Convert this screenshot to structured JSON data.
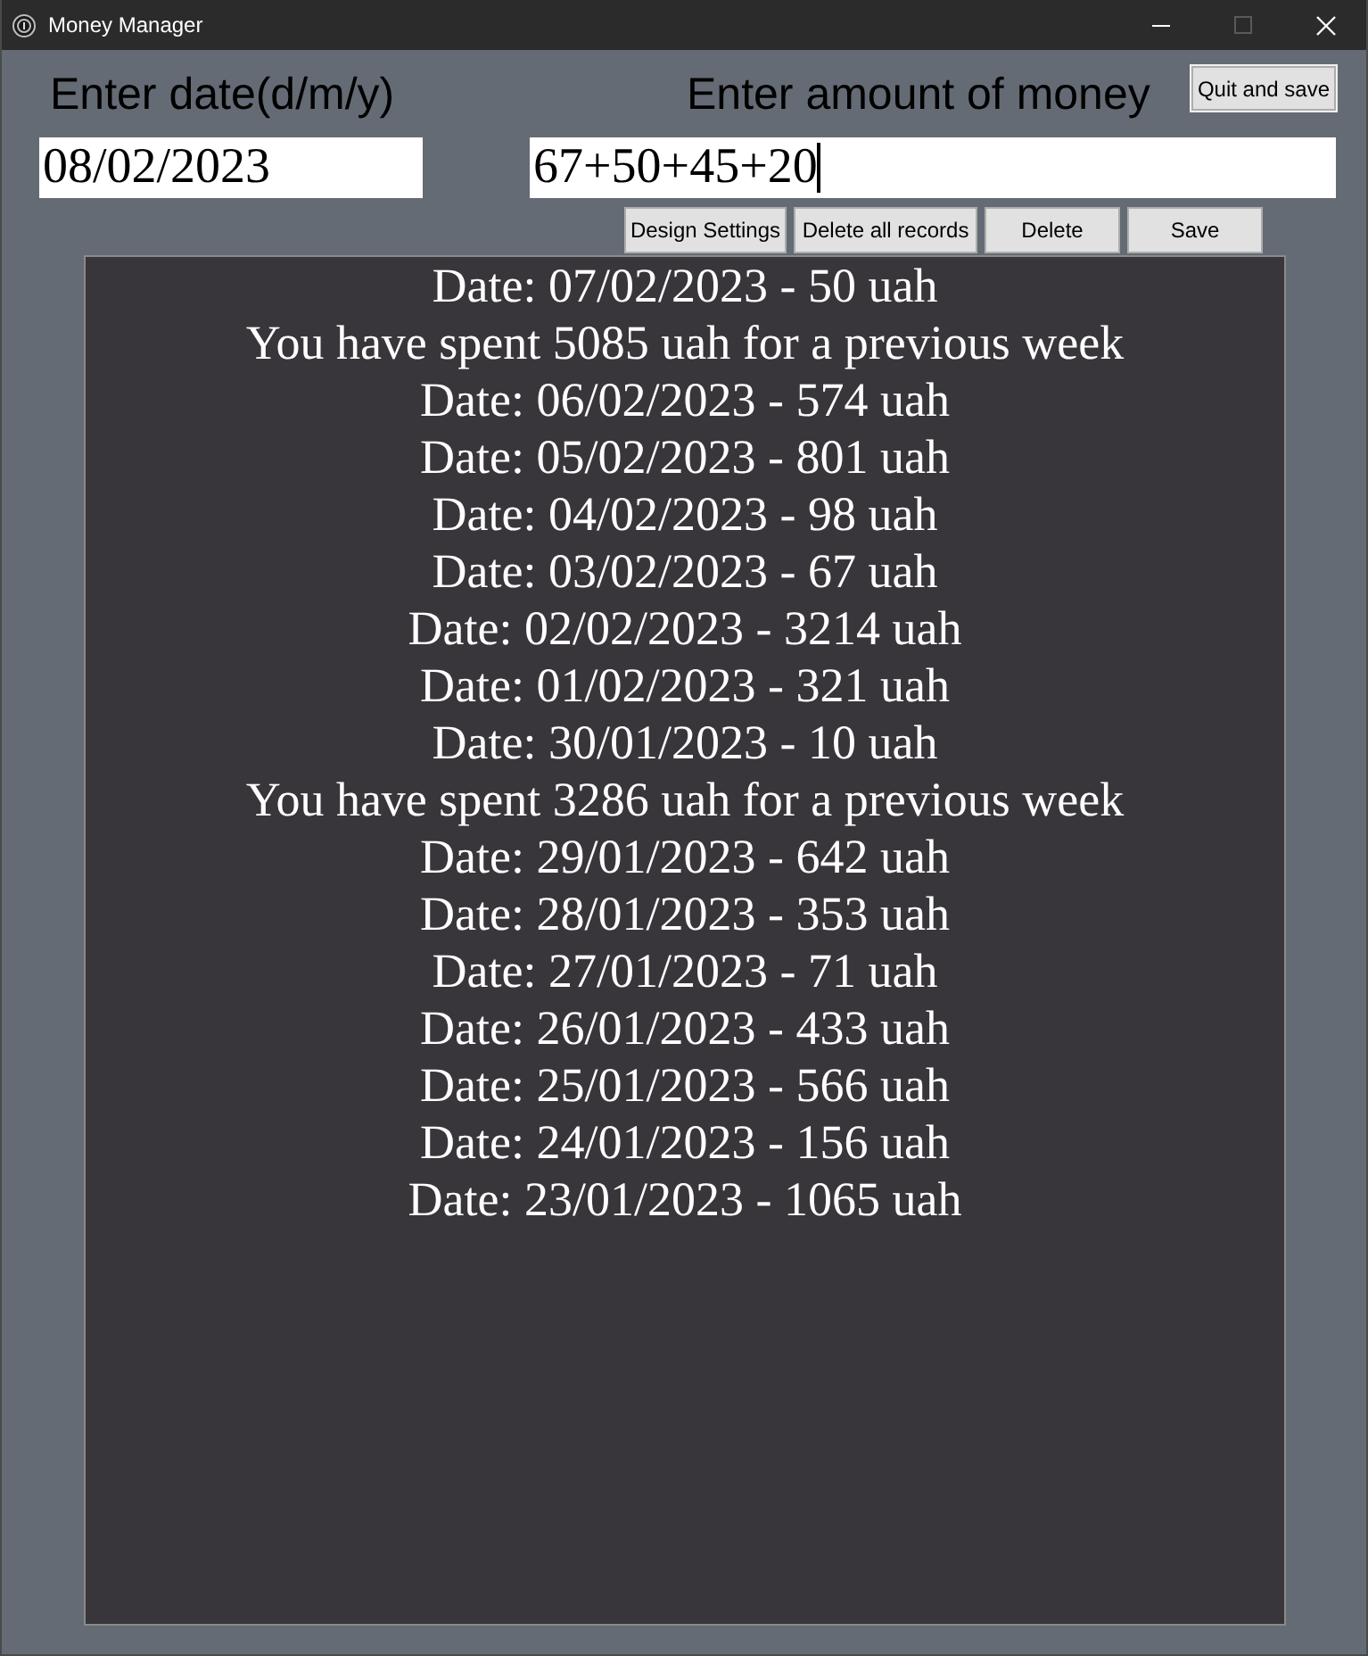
{
  "window": {
    "title": "Money Manager",
    "maximize_disabled": true
  },
  "fields": [
    {
      "label": "Enter date(d/m/y)",
      "value": "08/02/2023",
      "focused": false
    },
    {
      "label": "Enter amount of money",
      "value": "67+50+45+20",
      "focused": true
    }
  ],
  "quit_button": "Quit and save",
  "buttons": [
    "Design Settings",
    "Delete all records",
    "Delete",
    "Save"
  ],
  "records": [
    "Date: 07/02/2023 - 50 uah",
    "You have spent 5085 uah for a previous week",
    "Date: 06/02/2023 - 574 uah",
    "Date: 05/02/2023 - 801 uah",
    "Date: 04/02/2023 - 98 uah",
    "Date: 03/02/2023 - 67 uah",
    "Date: 02/02/2023 - 3214 uah",
    "Date: 01/02/2023 - 321 uah",
    "Date: 30/01/2023 - 10 uah",
    "You have spent 3286 uah for a previous week",
    "Date: 29/01/2023 - 642 uah",
    "Date: 28/01/2023 - 353 uah",
    "Date: 27/01/2023 - 71 uah",
    "Date: 26/01/2023 - 433 uah",
    "Date: 25/01/2023 - 566 uah",
    "Date: 24/01/2023 - 156 uah",
    "Date: 23/01/2023 - 1065 uah"
  ]
}
